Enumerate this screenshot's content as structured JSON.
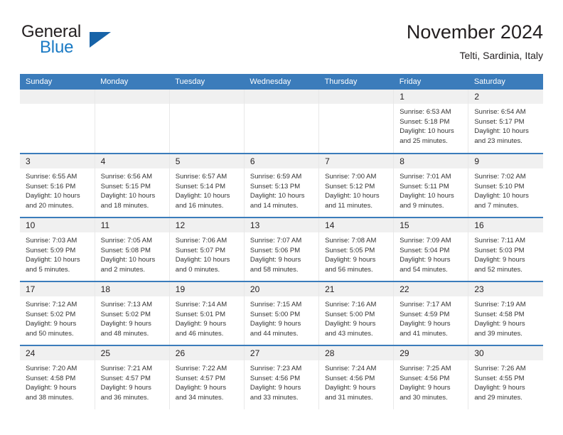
{
  "brand": {
    "name_part1": "General",
    "name_part2": "Blue",
    "triangle_color": "#1763a8",
    "blue_color": "#1a7ac4"
  },
  "header": {
    "title": "November 2024",
    "subtitle": "Telti, Sardinia, Italy"
  },
  "theme": {
    "header_blue": "#3b7cbb",
    "daynum_band": "#f0f0f0",
    "row_divider": "#3b7cbb",
    "column_divider": "#e8e8e8"
  },
  "weekday_headers": [
    "Sunday",
    "Monday",
    "Tuesday",
    "Wednesday",
    "Thursday",
    "Friday",
    "Saturday"
  ],
  "weeks": [
    [
      {
        "day": "",
        "lines": []
      },
      {
        "day": "",
        "lines": []
      },
      {
        "day": "",
        "lines": []
      },
      {
        "day": "",
        "lines": []
      },
      {
        "day": "",
        "lines": []
      },
      {
        "day": "1",
        "lines": [
          "Sunrise: 6:53 AM",
          "Sunset: 5:18 PM",
          "Daylight: 10 hours",
          "and 25 minutes."
        ]
      },
      {
        "day": "2",
        "lines": [
          "Sunrise: 6:54 AM",
          "Sunset: 5:17 PM",
          "Daylight: 10 hours",
          "and 23 minutes."
        ]
      }
    ],
    [
      {
        "day": "3",
        "lines": [
          "Sunrise: 6:55 AM",
          "Sunset: 5:16 PM",
          "Daylight: 10 hours",
          "and 20 minutes."
        ]
      },
      {
        "day": "4",
        "lines": [
          "Sunrise: 6:56 AM",
          "Sunset: 5:15 PM",
          "Daylight: 10 hours",
          "and 18 minutes."
        ]
      },
      {
        "day": "5",
        "lines": [
          "Sunrise: 6:57 AM",
          "Sunset: 5:14 PM",
          "Daylight: 10 hours",
          "and 16 minutes."
        ]
      },
      {
        "day": "6",
        "lines": [
          "Sunrise: 6:59 AM",
          "Sunset: 5:13 PM",
          "Daylight: 10 hours",
          "and 14 minutes."
        ]
      },
      {
        "day": "7",
        "lines": [
          "Sunrise: 7:00 AM",
          "Sunset: 5:12 PM",
          "Daylight: 10 hours",
          "and 11 minutes."
        ]
      },
      {
        "day": "8",
        "lines": [
          "Sunrise: 7:01 AM",
          "Sunset: 5:11 PM",
          "Daylight: 10 hours",
          "and 9 minutes."
        ]
      },
      {
        "day": "9",
        "lines": [
          "Sunrise: 7:02 AM",
          "Sunset: 5:10 PM",
          "Daylight: 10 hours",
          "and 7 minutes."
        ]
      }
    ],
    [
      {
        "day": "10",
        "lines": [
          "Sunrise: 7:03 AM",
          "Sunset: 5:09 PM",
          "Daylight: 10 hours",
          "and 5 minutes."
        ]
      },
      {
        "day": "11",
        "lines": [
          "Sunrise: 7:05 AM",
          "Sunset: 5:08 PM",
          "Daylight: 10 hours",
          "and 2 minutes."
        ]
      },
      {
        "day": "12",
        "lines": [
          "Sunrise: 7:06 AM",
          "Sunset: 5:07 PM",
          "Daylight: 10 hours",
          "and 0 minutes."
        ]
      },
      {
        "day": "13",
        "lines": [
          "Sunrise: 7:07 AM",
          "Sunset: 5:06 PM",
          "Daylight: 9 hours",
          "and 58 minutes."
        ]
      },
      {
        "day": "14",
        "lines": [
          "Sunrise: 7:08 AM",
          "Sunset: 5:05 PM",
          "Daylight: 9 hours",
          "and 56 minutes."
        ]
      },
      {
        "day": "15",
        "lines": [
          "Sunrise: 7:09 AM",
          "Sunset: 5:04 PM",
          "Daylight: 9 hours",
          "and 54 minutes."
        ]
      },
      {
        "day": "16",
        "lines": [
          "Sunrise: 7:11 AM",
          "Sunset: 5:03 PM",
          "Daylight: 9 hours",
          "and 52 minutes."
        ]
      }
    ],
    [
      {
        "day": "17",
        "lines": [
          "Sunrise: 7:12 AM",
          "Sunset: 5:02 PM",
          "Daylight: 9 hours",
          "and 50 minutes."
        ]
      },
      {
        "day": "18",
        "lines": [
          "Sunrise: 7:13 AM",
          "Sunset: 5:02 PM",
          "Daylight: 9 hours",
          "and 48 minutes."
        ]
      },
      {
        "day": "19",
        "lines": [
          "Sunrise: 7:14 AM",
          "Sunset: 5:01 PM",
          "Daylight: 9 hours",
          "and 46 minutes."
        ]
      },
      {
        "day": "20",
        "lines": [
          "Sunrise: 7:15 AM",
          "Sunset: 5:00 PM",
          "Daylight: 9 hours",
          "and 44 minutes."
        ]
      },
      {
        "day": "21",
        "lines": [
          "Sunrise: 7:16 AM",
          "Sunset: 5:00 PM",
          "Daylight: 9 hours",
          "and 43 minutes."
        ]
      },
      {
        "day": "22",
        "lines": [
          "Sunrise: 7:17 AM",
          "Sunset: 4:59 PM",
          "Daylight: 9 hours",
          "and 41 minutes."
        ]
      },
      {
        "day": "23",
        "lines": [
          "Sunrise: 7:19 AM",
          "Sunset: 4:58 PM",
          "Daylight: 9 hours",
          "and 39 minutes."
        ]
      }
    ],
    [
      {
        "day": "24",
        "lines": [
          "Sunrise: 7:20 AM",
          "Sunset: 4:58 PM",
          "Daylight: 9 hours",
          "and 38 minutes."
        ]
      },
      {
        "day": "25",
        "lines": [
          "Sunrise: 7:21 AM",
          "Sunset: 4:57 PM",
          "Daylight: 9 hours",
          "and 36 minutes."
        ]
      },
      {
        "day": "26",
        "lines": [
          "Sunrise: 7:22 AM",
          "Sunset: 4:57 PM",
          "Daylight: 9 hours",
          "and 34 minutes."
        ]
      },
      {
        "day": "27",
        "lines": [
          "Sunrise: 7:23 AM",
          "Sunset: 4:56 PM",
          "Daylight: 9 hours",
          "and 33 minutes."
        ]
      },
      {
        "day": "28",
        "lines": [
          "Sunrise: 7:24 AM",
          "Sunset: 4:56 PM",
          "Daylight: 9 hours",
          "and 31 minutes."
        ]
      },
      {
        "day": "29",
        "lines": [
          "Sunrise: 7:25 AM",
          "Sunset: 4:56 PM",
          "Daylight: 9 hours",
          "and 30 minutes."
        ]
      },
      {
        "day": "30",
        "lines": [
          "Sunrise: 7:26 AM",
          "Sunset: 4:55 PM",
          "Daylight: 9 hours",
          "and 29 minutes."
        ]
      }
    ]
  ]
}
